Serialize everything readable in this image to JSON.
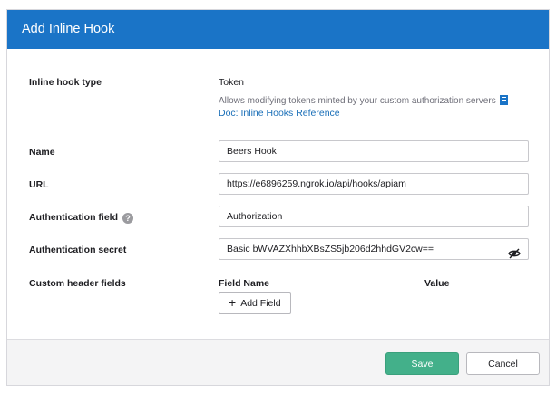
{
  "dialog": {
    "title": "Add Inline Hook"
  },
  "type_row": {
    "label": "Inline hook type",
    "value": "Token",
    "description": "Allows modifying tokens minted by your custom authorization servers",
    "doc_link": "Doc: Inline Hooks Reference",
    "doc_icon": "book-icon"
  },
  "fields": {
    "name": {
      "label": "Name",
      "value": "Beers Hook"
    },
    "url": {
      "label": "URL",
      "value": "https://e6896259.ngrok.io/api/hooks/apiam"
    },
    "auth_field": {
      "label": "Authentication field",
      "value": "Authorization",
      "help_icon": "?"
    },
    "auth_secret": {
      "label": "Authentication secret",
      "value": "Basic bWVAZXhhbXBsZS5jb206d2hhdGV2cw==",
      "toggle_icon": "eye-slash-icon"
    }
  },
  "custom_headers": {
    "label": "Custom header fields",
    "col_field_name": "Field Name",
    "col_value": "Value",
    "add_button": "Add Field",
    "add_icon": "+"
  },
  "footer": {
    "save_label": "Save",
    "cancel_label": "Cancel"
  },
  "colors": {
    "header": "#1a74c7",
    "save": "#43b08a",
    "link": "#1a6fb8"
  }
}
